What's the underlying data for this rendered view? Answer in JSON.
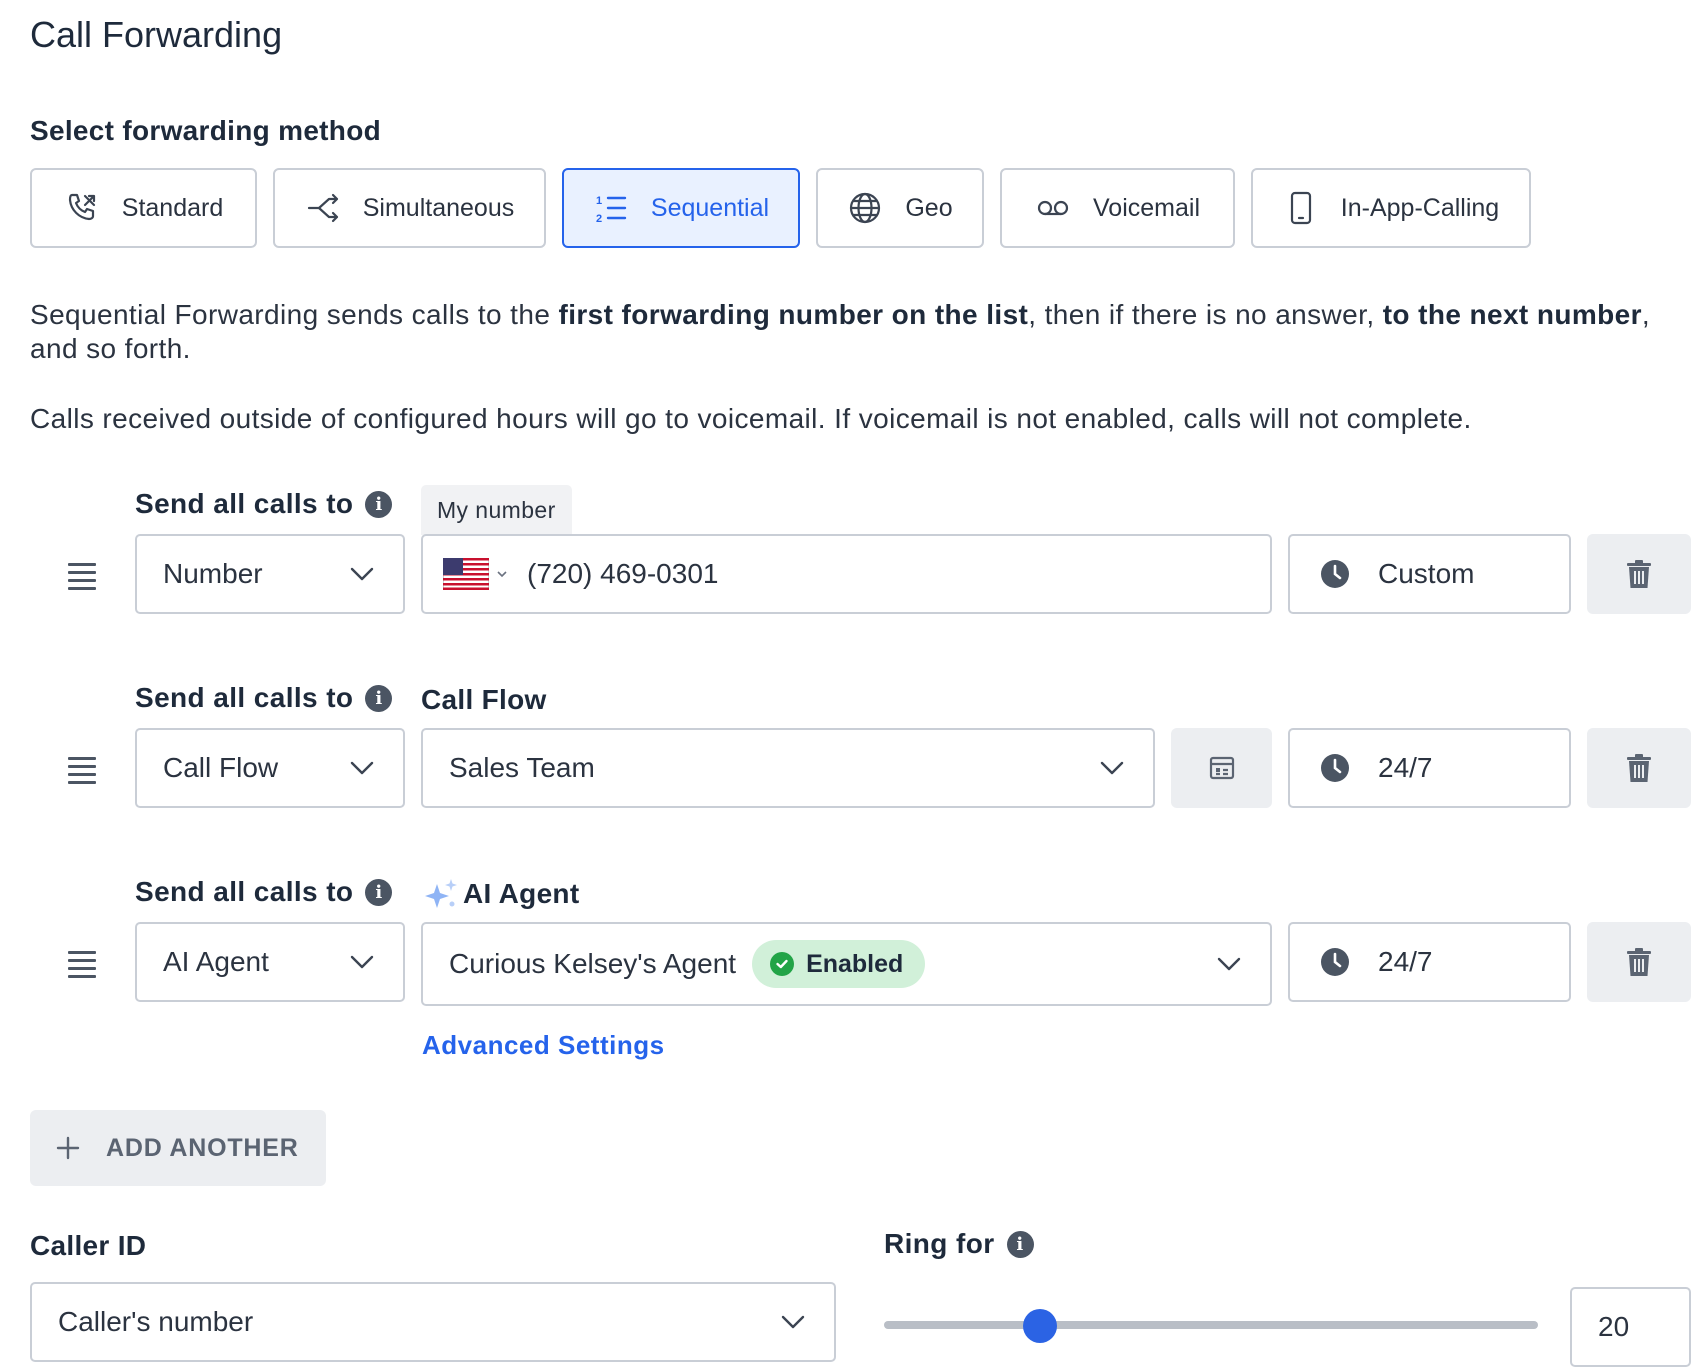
{
  "page": {
    "title": "Call Forwarding",
    "method_label": "Select forwarding method"
  },
  "methods": [
    {
      "label": "Standard",
      "icon": "phone-forward-icon",
      "active": false
    },
    {
      "label": "Simultaneous",
      "icon": "split-arrows-icon",
      "active": false
    },
    {
      "label": "Sequential",
      "icon": "numbered-list-icon",
      "active": true
    },
    {
      "label": "Geo",
      "icon": "globe-icon",
      "active": false
    },
    {
      "label": "Voicemail",
      "icon": "voicemail-icon",
      "active": false
    },
    {
      "label": "In-App-Calling",
      "icon": "mobile-phone-icon",
      "active": false
    }
  ],
  "description": {
    "p1_a": "Sequential Forwarding sends calls to the ",
    "p1_b": "first forwarding number on the list",
    "p1_c": ", then if there is no answer, ",
    "p1_d": "to the next number",
    "p1_e": ", and so forth.",
    "p2": "Calls received outside of configured hours will go to voicemail. If voicemail is not enabled, calls will not complete."
  },
  "rows": [
    {
      "label": "Send all calls to",
      "target_label": "My number",
      "type": "Number",
      "phone": "(720) 469-0301",
      "schedule": "Custom"
    },
    {
      "label": "Send all calls to",
      "target_label": "Call Flow",
      "type": "Call Flow",
      "value": "Sales Team",
      "schedule": "24/7"
    },
    {
      "label": "Send all calls to",
      "target_label": "AI Agent",
      "type": "AI Agent",
      "value": "Curious Kelsey's Agent",
      "badge": "Enabled",
      "schedule": "24/7",
      "advanced_link": "Advanced Settings"
    }
  ],
  "add_another": "ADD ANOTHER",
  "caller_id": {
    "label": "Caller ID",
    "value": "Caller's number"
  },
  "ring_for": {
    "label": "Ring for",
    "value": "20",
    "slider_fraction": 0.21
  },
  "colors": {
    "accent": "#2563eb",
    "enabled_badge_bg": "#d1f0d9",
    "enabled_check": "#22a447"
  }
}
